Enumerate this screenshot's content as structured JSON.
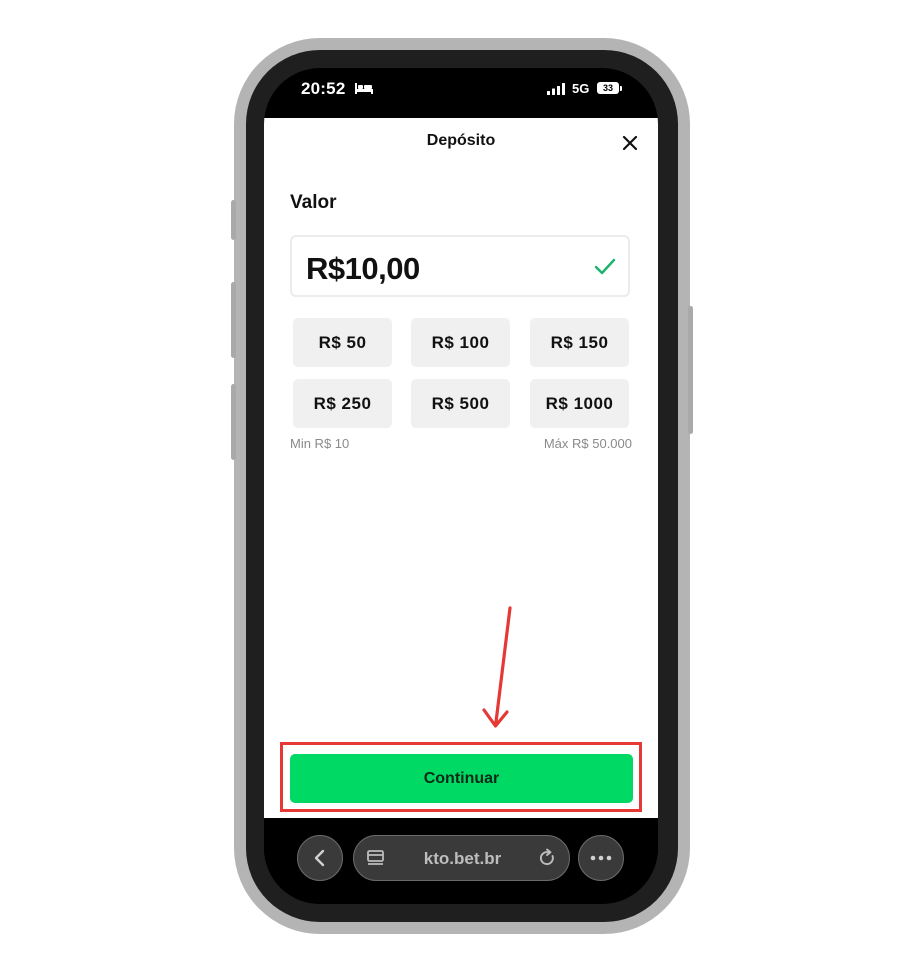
{
  "status_bar": {
    "time": "20:52",
    "network": "5G",
    "battery": "33",
    "icons": [
      "bed-icon",
      "signal-icon",
      "battery-icon"
    ]
  },
  "modal": {
    "title": "Depósito",
    "close_icon": "close-icon",
    "field_label": "Valor",
    "amount": "R$10,00",
    "valid_icon": "check-icon",
    "quick_amounts": [
      "R$ 50",
      "R$ 100",
      "R$ 150",
      "R$ 250",
      "R$ 500",
      "R$ 1000"
    ],
    "min_hint": "Min R$ 10",
    "max_hint": "Máx R$ 50.000",
    "continue_label": "Continuar"
  },
  "browser": {
    "url": "kto.bet.br",
    "icons": [
      "back-icon",
      "tabs-icon",
      "reload-icon",
      "more-icon"
    ]
  },
  "colors": {
    "accent": "#00d964",
    "check": "#19b46b",
    "annotation": "#e53935"
  }
}
